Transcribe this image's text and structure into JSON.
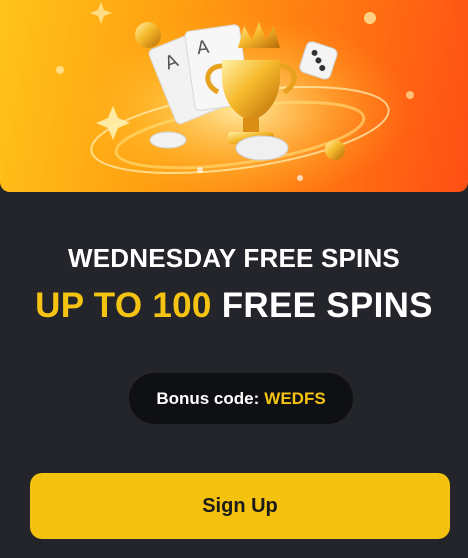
{
  "promo": {
    "title": "WEDNESDAY FREE SPINS",
    "headline_accent": "UP TO 100",
    "headline_rest": "FREE SPINS",
    "bonus_label": "Bonus code:",
    "bonus_code": "WEDFS",
    "signup_label": "Sign Up"
  },
  "icons": {
    "hero_art": "trophy-cards-dice-illustration"
  },
  "colors": {
    "accent": "#f5c312",
    "button": "#f4c10e",
    "panel": "#24252b",
    "pill": "#0f1014"
  }
}
